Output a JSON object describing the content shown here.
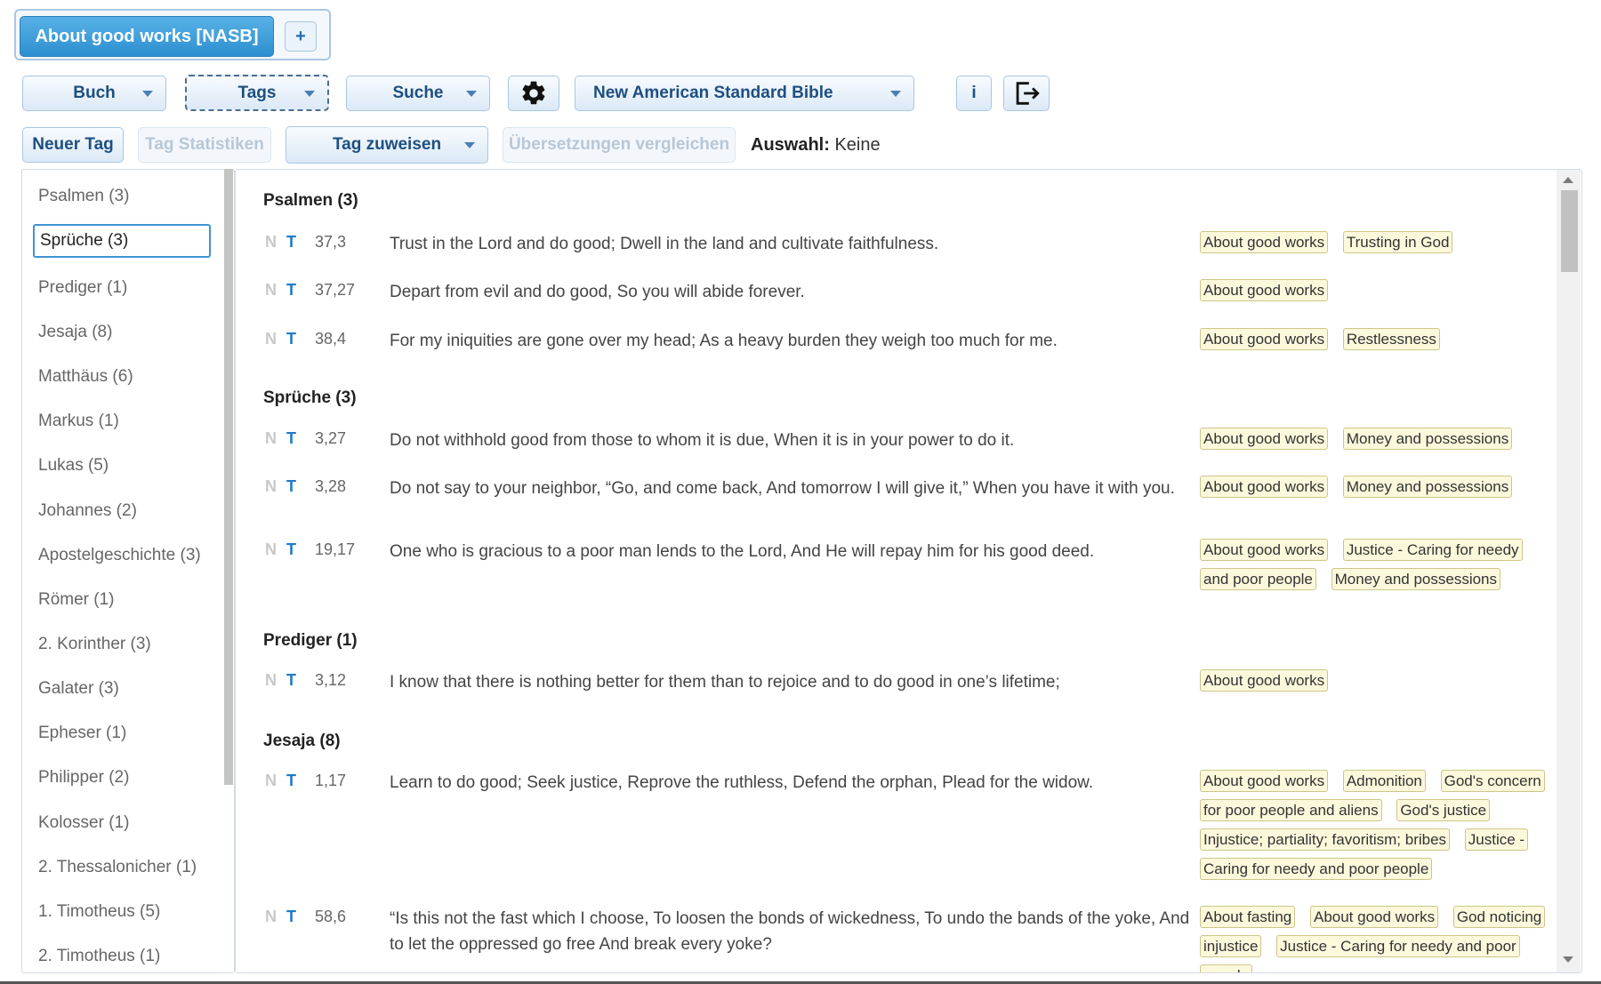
{
  "tabs": {
    "active_label": "About good works [NASB]",
    "add_label": "+"
  },
  "toolbar": {
    "book_label": "Buch",
    "tags_label": "Tags",
    "search_label": "Suche",
    "translation_label": "New American Standard Bible",
    "info_label": "i"
  },
  "toolbar2": {
    "new_tag_label": "Neuer Tag",
    "tag_stats_label": "Tag Statistiken",
    "assign_tag_label": "Tag zuweisen",
    "compare_label": "Übersetzungen vergleichen",
    "selection_label": "Auswahl:",
    "selection_value": "Keine"
  },
  "sidebar": {
    "books": [
      "Psalmen (3)",
      "Sprüche (3)",
      "Prediger (1)",
      "Jesaja (8)",
      "Matthäus (6)",
      "Markus (1)",
      "Lukas (5)",
      "Johannes (2)",
      "Apostelgeschichte (3)",
      "Römer (1)",
      "2. Korinther (3)",
      "Galater (3)",
      "Epheser (1)",
      "Philipper (2)",
      "Kolosser (1)",
      "2. Thessalonicher (1)",
      "1. Timotheus (5)",
      "2. Timotheus (1)"
    ],
    "selected_index": 1
  },
  "main": {
    "markers": {
      "note": "N",
      "tag": "T"
    },
    "sections": [
      {
        "title": "Psalmen (3)",
        "verses": [
          {
            "ref": "37,3",
            "text": "Trust in the Lord and do good; Dwell in the land and cultivate faithfulness.",
            "tags": [
              "About good works",
              "Trusting in God"
            ]
          },
          {
            "ref": "37,27",
            "text": "Depart from evil and do good, So you will abide forever.",
            "tags": [
              "About good works"
            ]
          },
          {
            "ref": "38,4",
            "text": "For my iniquities are gone over my head; As a heavy burden they weigh too much for me.",
            "tags": [
              "About good works",
              "Restlessness"
            ]
          }
        ]
      },
      {
        "title": "Sprüche (3)",
        "verses": [
          {
            "ref": "3,27",
            "text": "Do not withhold good from those to whom it is due, When it is in your power to do it.",
            "tags": [
              "About good works",
              "Money and possessions"
            ]
          },
          {
            "ref": "3,28",
            "text": "Do not say to your neighbor, “Go, and come back, And tomorrow I will give it,” When you have it with you.",
            "tags": [
              "About good works",
              "Money and possessions"
            ]
          },
          {
            "ref": "19,17",
            "text": "One who is gracious to a poor man lends to the Lord, And He will repay him for his good deed.",
            "tags": [
              "About good works",
              "Justice - Caring for needy and poor people",
              "Money and possessions"
            ]
          }
        ]
      },
      {
        "title": "Prediger (1)",
        "verses": [
          {
            "ref": "3,12",
            "text": "I know that there is nothing better for them than to rejoice and to do good in one’s lifetime;",
            "tags": [
              "About good works"
            ]
          }
        ]
      },
      {
        "title": "Jesaja (8)",
        "verses": [
          {
            "ref": "1,17",
            "text": "Learn to do good; Seek justice, Reprove the ruthless, Defend the orphan, Plead for the widow.",
            "tags": [
              "About good works",
              "Admonition",
              "God's concern for poor people and aliens",
              "God's justice",
              "Injustice; partiality; favoritism; bribes",
              "Justice - Caring for needy and poor people"
            ]
          },
          {
            "ref": "58,6",
            "text": "“Is this not the fast which I choose, To loosen the bonds of wickedness, To undo the bands of the yoke, And to let the oppressed go free And break every yoke?",
            "tags": [
              "About fasting",
              "About good works",
              "God noticing injustice",
              "Justice - Caring for needy and poor people"
            ]
          }
        ]
      }
    ]
  },
  "colors": {
    "accent": "#2d8fd0",
    "tag_bg": "#fcf8dc",
    "tag_border": "#cfc58a",
    "selected_border": "#3d94d6"
  },
  "icons": {
    "settings": "gear-icon",
    "logout": "logout-icon"
  }
}
